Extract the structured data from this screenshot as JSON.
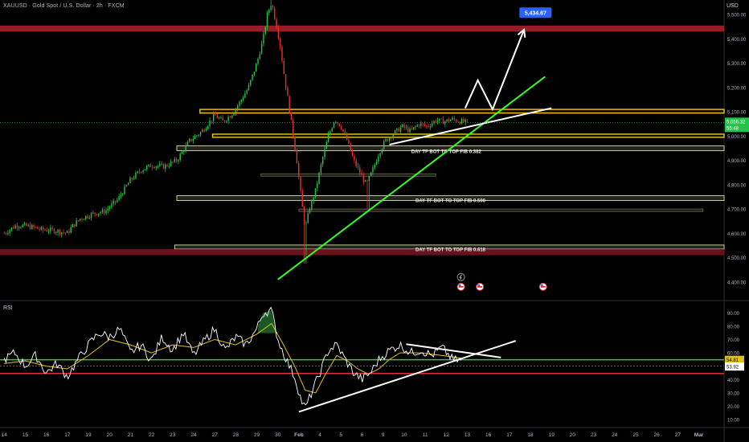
{
  "header": {
    "symbol_title": "XAUUSD · Gold Spot / U.S. Dollar · 2h · FXCM",
    "currency": "USD"
  },
  "colors": {
    "background": "#000000",
    "candle_up": "#26c24a",
    "candle_down": "#e0312f",
    "resistance_zone": "#b0222f",
    "demand_zone": "#7a1522",
    "support_outline": "#f0c419",
    "fib_box": "#c8c8a0",
    "trend_green": "#33ff22",
    "trend_white": "#ffffff",
    "target_label": "#2962ff",
    "rsi_line": "#ffffff",
    "rsi_ma": "#e0c020",
    "rsi_upper": "#3fbf4f",
    "rsi_lower": "#e0313f"
  },
  "chart_data": [
    {
      "type": "candlestick",
      "title": "XAUUSD · Gold Spot / U.S. Dollar · 2h · FXCM",
      "currency": "USD",
      "ylim": [
        4330,
        5560
      ],
      "y_ticks": [
        "5,500.00",
        "5,400.00",
        "5,300.00",
        "5,200.00",
        "5,100.00",
        "5,000.00",
        "4,900.00",
        "4,800.00",
        "4,700.00",
        "4,600.00",
        "4,500.00",
        "4,400.00"
      ],
      "x_ticks": [
        "14",
        "15",
        "16",
        "17",
        "19",
        "20",
        "21",
        "22",
        "23",
        "24",
        "27",
        "28",
        "29",
        "30",
        "Feb",
        "4",
        "5",
        "6",
        "9",
        "10",
        "11",
        "12",
        "13",
        "16",
        "17",
        "18",
        "19",
        "20",
        "23",
        "24",
        "25",
        "26",
        "27",
        "Mar"
      ],
      "x_tick_pos": [
        0,
        1,
        2,
        3,
        4,
        5,
        6,
        7,
        8,
        9,
        10,
        11,
        12,
        13,
        14,
        15,
        16,
        17,
        18,
        19,
        20,
        21,
        22,
        23,
        24,
        25,
        26,
        27,
        28,
        29,
        30,
        31,
        32,
        33
      ],
      "x_range": [
        -0.2,
        34.2
      ],
      "current_price_label": "5,056.32",
      "countdown_label": "55:48",
      "target_price_label": "5,434.67",
      "price_path": [
        [
          0.0,
          4600
        ],
        [
          0.6,
          4635
        ],
        [
          1.2,
          4628
        ],
        [
          1.8,
          4615
        ],
        [
          2.4,
          4612
        ],
        [
          3.0,
          4600
        ],
        [
          3.2,
          4625
        ],
        [
          3.6,
          4660
        ],
        [
          4.2,
          4680
        ],
        [
          4.8,
          4692
        ],
        [
          5.4,
          4740
        ],
        [
          6.0,
          4820
        ],
        [
          6.5,
          4860
        ],
        [
          7.0,
          4880
        ],
        [
          7.6,
          4875
        ],
        [
          8.2,
          4900
        ],
        [
          8.8,
          4980
        ],
        [
          9.4,
          5020
        ],
        [
          10.0,
          5085
        ],
        [
          10.4,
          5060
        ],
        [
          10.8,
          5090
        ],
        [
          11.2,
          5140
        ],
        [
          11.6,
          5200
        ],
        [
          12.0,
          5300
        ],
        [
          12.3,
          5400
        ],
        [
          12.5,
          5500
        ],
        [
          12.7,
          5550
        ],
        [
          12.9,
          5470
        ],
        [
          13.1,
          5380
        ],
        [
          13.3,
          5250
        ],
        [
          13.6,
          5080
        ],
        [
          13.9,
          4900
        ],
        [
          14.1,
          4750
        ],
        [
          14.3,
          4620
        ],
        [
          14.5,
          4700
        ],
        [
          14.8,
          4780
        ],
        [
          15.1,
          4900
        ],
        [
          15.4,
          5000
        ],
        [
          15.7,
          5070
        ],
        [
          16.0,
          5040
        ],
        [
          16.3,
          4980
        ],
        [
          16.6,
          4900
        ],
        [
          16.9,
          4850
        ],
        [
          17.2,
          4800
        ],
        [
          17.5,
          4860
        ],
        [
          17.8,
          4930
        ],
        [
          18.1,
          4980
        ],
        [
          18.5,
          5010
        ],
        [
          18.9,
          5040
        ],
        [
          19.3,
          5020
        ],
        [
          19.7,
          5050
        ],
        [
          20.1,
          5040
        ],
        [
          20.5,
          5065
        ],
        [
          20.9,
          5060
        ],
        [
          21.3,
          5070
        ],
        [
          21.7,
          5060
        ],
        [
          22.0,
          5056
        ]
      ],
      "extrema": [
        [
          12.7,
          5565
        ],
        [
          14.3,
          4475
        ],
        [
          17.3,
          4700
        ]
      ],
      "zones": [
        {
          "kind": "resistance",
          "from": 5430,
          "to": 5455,
          "x": [
            -0.2,
            34.2
          ]
        },
        {
          "kind": "support",
          "from": 5095,
          "to": 5110,
          "x": [
            9.3,
            34.2
          ]
        },
        {
          "kind": "support",
          "from": 4995,
          "to": 5008,
          "x": [
            9.9,
            34.2
          ]
        },
        {
          "kind": "fib",
          "from": 4940,
          "to": 4960,
          "x": [
            8.2,
            34.2
          ]
        },
        {
          "kind": "fib_dim",
          "from": 4835,
          "to": 4845,
          "x": [
            12.2,
            20.5
          ]
        },
        {
          "kind": "fib",
          "from": 4735,
          "to": 4755,
          "x": [
            8.2,
            34.2
          ]
        },
        {
          "kind": "fib_dim",
          "from": 4690,
          "to": 4700,
          "x": [
            14.0,
            33.2
          ]
        },
        {
          "kind": "fib",
          "from": 4535,
          "to": 4552,
          "x": [
            8.1,
            34.2
          ]
        },
        {
          "kind": "demand",
          "from": 4510,
          "to": 4535,
          "x": [
            -0.2,
            34.2
          ]
        }
      ],
      "fib_labels": [
        {
          "text": "DAY TF BOT TO TOP FIB 0.382",
          "x": 21.0,
          "y": 4930
        },
        {
          "text": "DAY TF BOT TO TOP FIB 0.500",
          "x": 21.2,
          "y": 4728
        },
        {
          "text": "DAY TF BOT TO TOP FIB 0.618",
          "x": 21.2,
          "y": 4526
        }
      ],
      "trendlines": [
        {
          "color": "green",
          "from": [
            13.0,
            4410
          ],
          "to": [
            25.7,
            5245
          ]
        },
        {
          "color": "white",
          "from": [
            18.3,
            4965
          ],
          "to": [
            26.0,
            5115
          ]
        }
      ],
      "projection_path": [
        [
          21.9,
          5115
        ],
        [
          22.5,
          5230
        ],
        [
          23.2,
          5110
        ],
        [
          24.5,
          5395
        ]
      ],
      "target_point": [
        24.4,
        5440
      ],
      "event_icons": [
        {
          "x": 21.7,
          "y": 4420
        },
        {
          "x": 21.7,
          "y": 4380
        },
        {
          "x": 22.6,
          "y": 4380
        },
        {
          "x": 25.6,
          "y": 4380
        }
      ]
    },
    {
      "type": "line",
      "title": "RSI",
      "ylim": [
        4,
        98
      ],
      "y_ticks": [
        "90.00",
        "80.00",
        "70.00",
        "60.00",
        "50.00",
        "40.00",
        "30.00",
        "20.00",
        "10.00"
      ],
      "upper_band": 54.81,
      "lower_band": 44.5,
      "mid_band": 50,
      "labels": [
        "54.81",
        "53.92"
      ],
      "rsi_path": [
        [
          0.0,
          55
        ],
        [
          0.5,
          60
        ],
        [
          1.0,
          50
        ],
        [
          1.5,
          58
        ],
        [
          2.0,
          45
        ],
        [
          2.5,
          52
        ],
        [
          3.0,
          42
        ],
        [
          3.5,
          55
        ],
        [
          4.0,
          66
        ],
        [
          4.5,
          75
        ],
        [
          5.0,
          72
        ],
        [
          5.5,
          78
        ],
        [
          6.0,
          60
        ],
        [
          6.5,
          66
        ],
        [
          7.0,
          54
        ],
        [
          7.5,
          72
        ],
        [
          8.0,
          62
        ],
        [
          8.5,
          75
        ],
        [
          9.0,
          58
        ],
        [
          9.5,
          69
        ],
        [
          10.0,
          78
        ],
        [
          10.5,
          62
        ],
        [
          11.0,
          72
        ],
        [
          11.5,
          66
        ],
        [
          12.0,
          78
        ],
        [
          12.3,
          90
        ],
        [
          12.7,
          92
        ],
        [
          13.0,
          70
        ],
        [
          13.4,
          55
        ],
        [
          13.8,
          42
        ],
        [
          14.1,
          25
        ],
        [
          14.3,
          18
        ],
        [
          14.6,
          30
        ],
        [
          15.0,
          45
        ],
        [
          15.4,
          62
        ],
        [
          15.8,
          66
        ],
        [
          16.2,
          55
        ],
        [
          16.6,
          45
        ],
        [
          17.0,
          40
        ],
        [
          17.4,
          45
        ],
        [
          17.8,
          55
        ],
        [
          18.3,
          62
        ],
        [
          18.8,
          66
        ],
        [
          19.3,
          60
        ],
        [
          19.8,
          62
        ],
        [
          20.3,
          58
        ],
        [
          20.8,
          64
        ],
        [
          21.3,
          55
        ],
        [
          21.7,
          53.9
        ]
      ],
      "rsi_ma_path": [
        [
          0.0,
          52
        ],
        [
          1.0,
          54
        ],
        [
          2.0,
          50
        ],
        [
          3.0,
          48
        ],
        [
          4.0,
          58
        ],
        [
          5.0,
          70
        ],
        [
          6.0,
          66
        ],
        [
          7.0,
          60
        ],
        [
          8.0,
          66
        ],
        [
          9.0,
          64
        ],
        [
          10.0,
          70
        ],
        [
          11.0,
          66
        ],
        [
          12.0,
          74
        ],
        [
          12.7,
          82
        ],
        [
          13.2,
          68
        ],
        [
          13.8,
          50
        ],
        [
          14.3,
          32
        ],
        [
          14.8,
          30
        ],
        [
          15.3,
          45
        ],
        [
          15.8,
          58
        ],
        [
          16.3,
          54
        ],
        [
          16.8,
          48
        ],
        [
          17.3,
          44
        ],
        [
          17.8,
          48
        ],
        [
          18.3,
          55
        ],
        [
          18.8,
          60
        ],
        [
          19.3,
          60
        ],
        [
          19.8,
          60
        ],
        [
          20.3,
          59
        ],
        [
          20.8,
          58
        ],
        [
          21.3,
          57
        ],
        [
          21.7,
          56
        ]
      ],
      "trendlines": [
        {
          "color": "white",
          "from": [
            14.0,
            15.8
          ],
          "to": [
            24.3,
            69.0
          ]
        },
        {
          "color": "white",
          "from": [
            19.1,
            66.5
          ],
          "to": [
            23.6,
            56.5
          ]
        }
      ]
    }
  ],
  "rsi_label": "RSI"
}
